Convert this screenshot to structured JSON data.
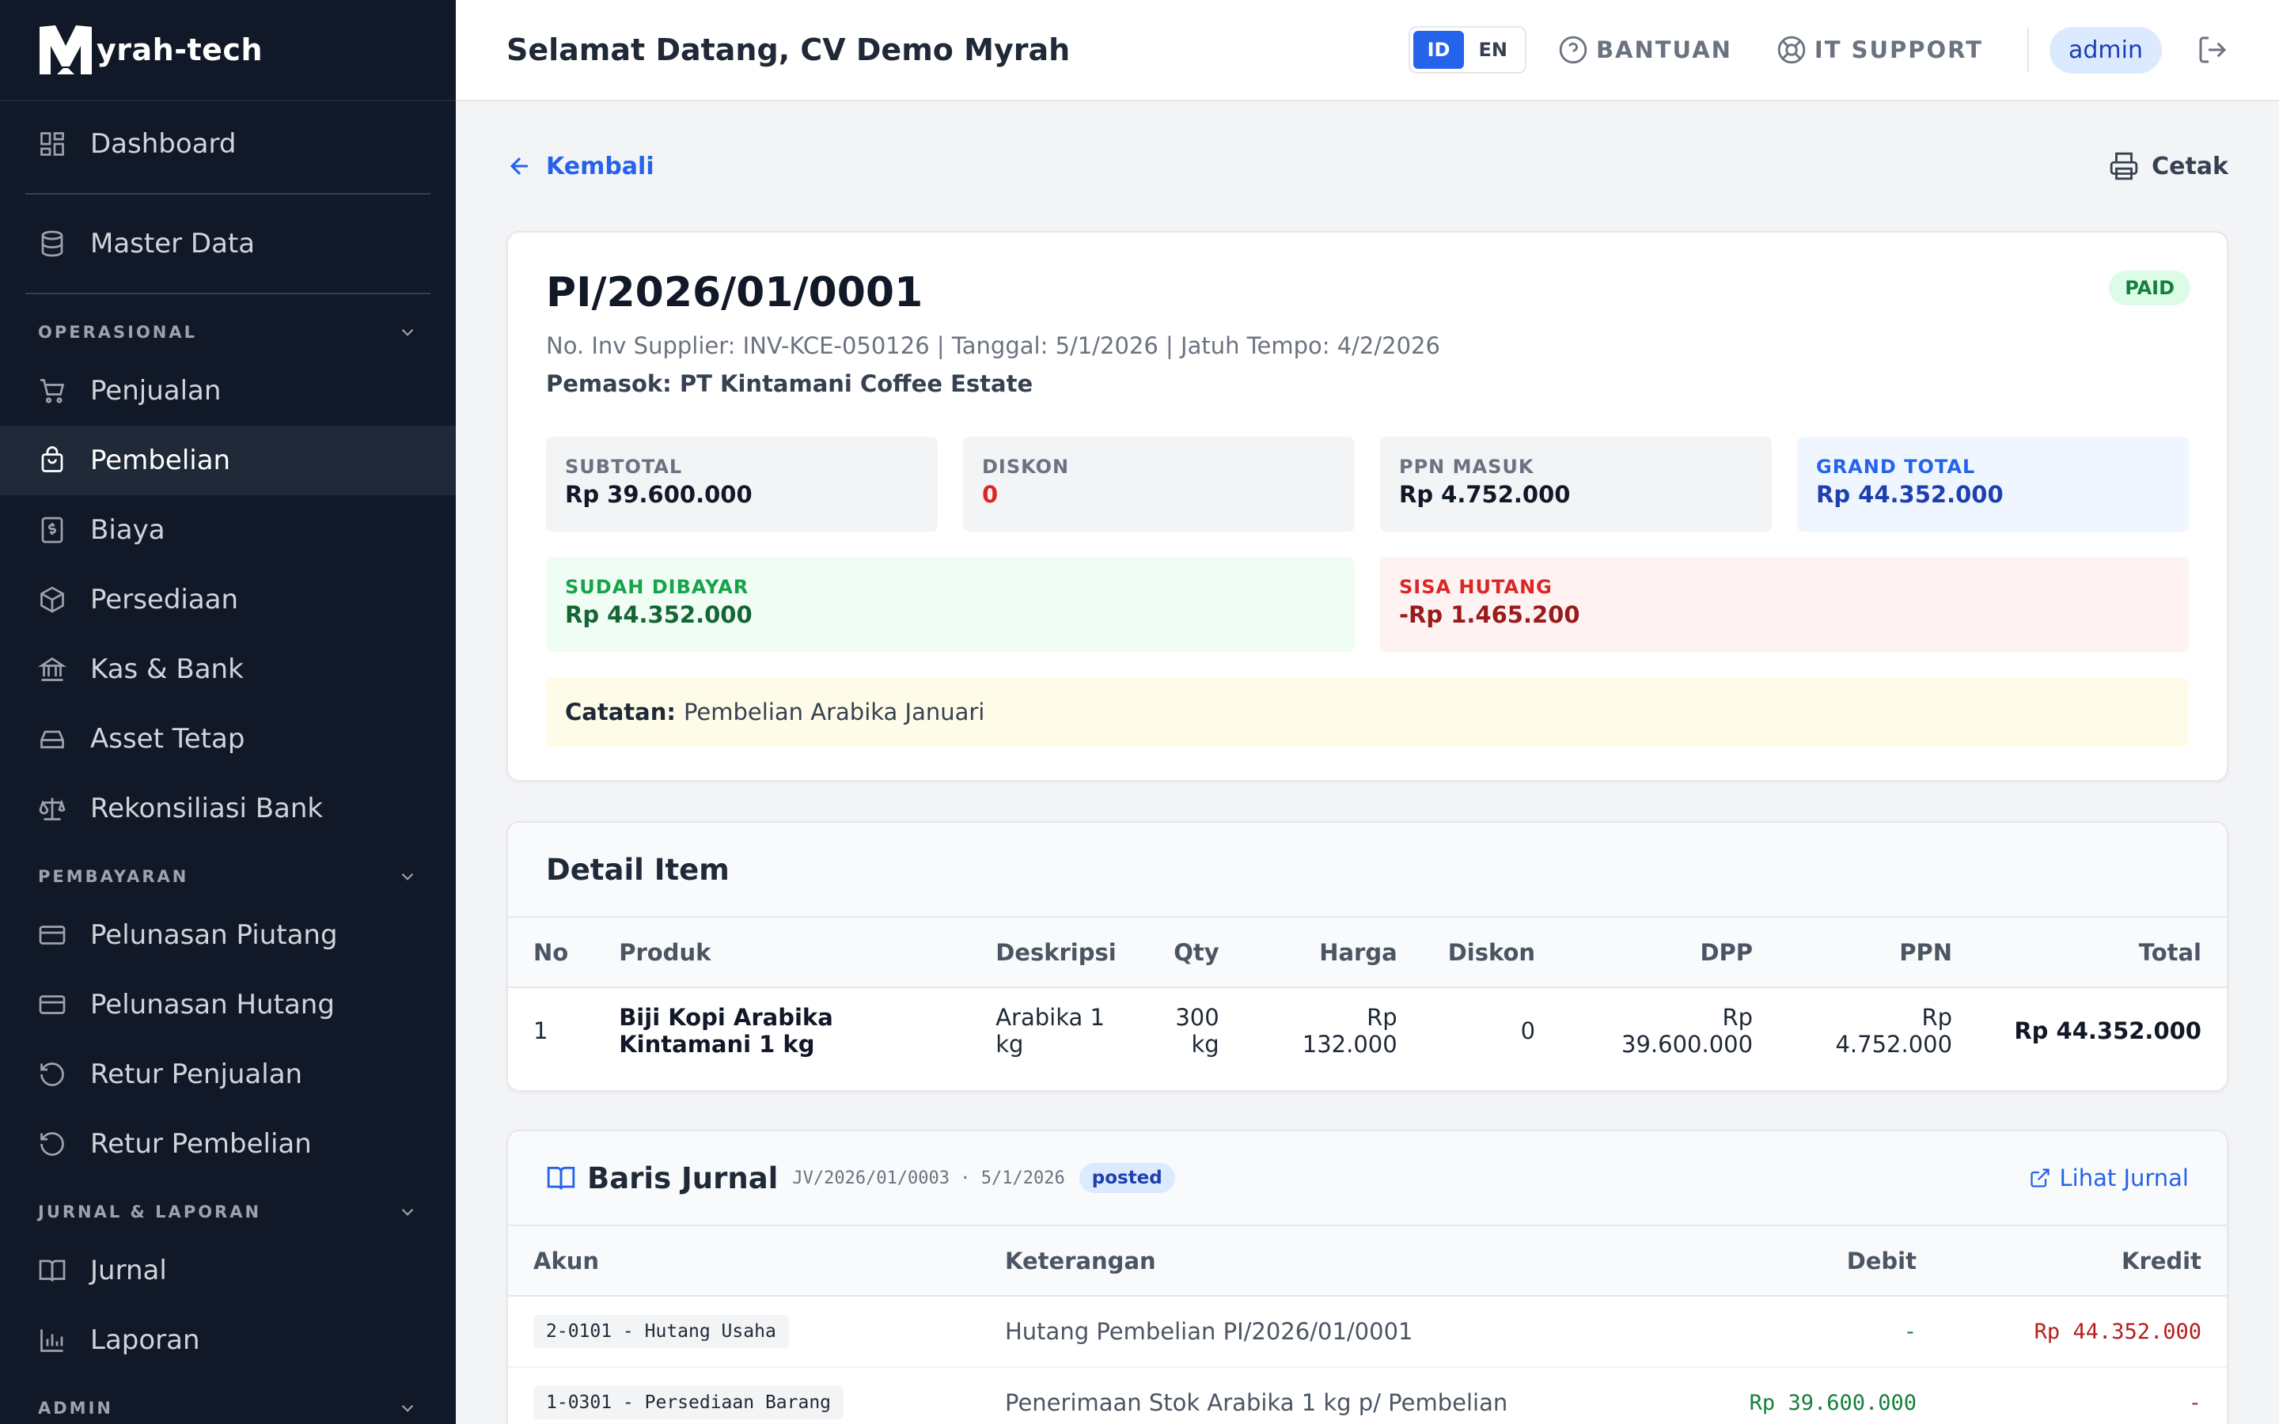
{
  "brand": {
    "logo_letter": "M",
    "name": "yrah-tech"
  },
  "sidebar": {
    "top_items": [
      {
        "label": "Dashboard",
        "icon": "dashboard-icon"
      },
      {
        "label": "Master Data",
        "icon": "database-icon"
      }
    ],
    "sections": [
      {
        "title": "OPERASIONAL",
        "items": [
          {
            "label": "Penjualan",
            "icon": "cart-icon"
          },
          {
            "label": "Pembelian",
            "icon": "shopping-bag-icon",
            "active": true
          },
          {
            "label": "Biaya",
            "icon": "receipt-icon"
          },
          {
            "label": "Persediaan",
            "icon": "box-icon"
          },
          {
            "label": "Kas & Bank",
            "icon": "bank-icon"
          },
          {
            "label": "Asset Tetap",
            "icon": "hard-drive-icon"
          },
          {
            "label": "Rekonsiliasi Bank",
            "icon": "scale-icon"
          }
        ]
      },
      {
        "title": "PEMBAYARAN",
        "items": [
          {
            "label": "Pelunasan Piutang",
            "icon": "credit-card-icon"
          },
          {
            "label": "Pelunasan Hutang",
            "icon": "credit-card-icon"
          },
          {
            "label": "Retur Penjualan",
            "icon": "undo-icon"
          },
          {
            "label": "Retur Pembelian",
            "icon": "undo-icon"
          }
        ]
      },
      {
        "title": "JURNAL & LAPORAN",
        "items": [
          {
            "label": "Jurnal",
            "icon": "book-icon"
          },
          {
            "label": "Laporan",
            "icon": "bar-chart-icon"
          }
        ]
      },
      {
        "title": "ADMIN",
        "items": []
      }
    ]
  },
  "header": {
    "welcome": "Selamat Datang, CV Demo Myrah",
    "lang_id": "ID",
    "lang_en": "EN",
    "help": "BANTUAN",
    "support": "IT SUPPORT",
    "user": "admin"
  },
  "toolbar": {
    "back": "Kembali",
    "print": "Cetak"
  },
  "invoice": {
    "number": "PI/2026/01/0001",
    "status": "PAID",
    "meta": "No. Inv Supplier: INV-KCE-050126 | Tanggal: 5/1/2026 | Jatuh Tempo: 4/2/2026",
    "supplier": "Pemasok: PT Kintamani Coffee Estate",
    "subtotal_label": "SUBTOTAL",
    "subtotal": "Rp 39.600.000",
    "diskon_label": "DISKON",
    "diskon": "0",
    "ppn_label": "PPN MASUK",
    "ppn": "Rp 4.752.000",
    "grand_label": "GRAND TOTAL",
    "grand": "Rp 44.352.000",
    "paid_label": "SUDAH DIBAYAR",
    "paid": "Rp 44.352.000",
    "remaining_label": "SISA HUTANG",
    "remaining": "-Rp 1.465.200",
    "note_label": "Catatan:",
    "note": "Pembelian Arabika Januari"
  },
  "detail": {
    "title": "Detail Item",
    "columns": [
      "No",
      "Produk",
      "Deskripsi",
      "Qty",
      "Harga",
      "Diskon",
      "DPP",
      "PPN",
      "Total"
    ],
    "rows": [
      {
        "no": "1",
        "produk": "Biji Kopi Arabika Kintamani 1 kg",
        "deskripsi": "Arabika 1 kg",
        "qty": "300 kg",
        "harga": "Rp 132.000",
        "diskon": "0",
        "dpp": "Rp 39.600.000",
        "ppn": "Rp 4.752.000",
        "total": "Rp 44.352.000"
      }
    ]
  },
  "journal": {
    "title": "Baris Jurnal",
    "meta": "JV/2026/01/0003 · 5/1/2026",
    "status": "posted",
    "link": "Lihat Jurnal",
    "columns": [
      "Akun",
      "Keterangan",
      "Debit",
      "Kredit"
    ],
    "rows": [
      {
        "akun": "2-0101 - Hutang Usaha",
        "ket": "Hutang Pembelian PI/2026/01/0001",
        "debit": "-",
        "kredit": "Rp 44.352.000"
      },
      {
        "akun": "1-0301 - Persediaan Barang",
        "ket": "Penerimaan Stok Arabika 1 kg p/ Pembelian",
        "debit": "Rp 39.600.000",
        "kredit": "-"
      }
    ]
  },
  "colors": {
    "sidebar_bg": "#111827",
    "accent": "#2563eb",
    "paid": "#15803d",
    "debt": "#dc2626"
  }
}
